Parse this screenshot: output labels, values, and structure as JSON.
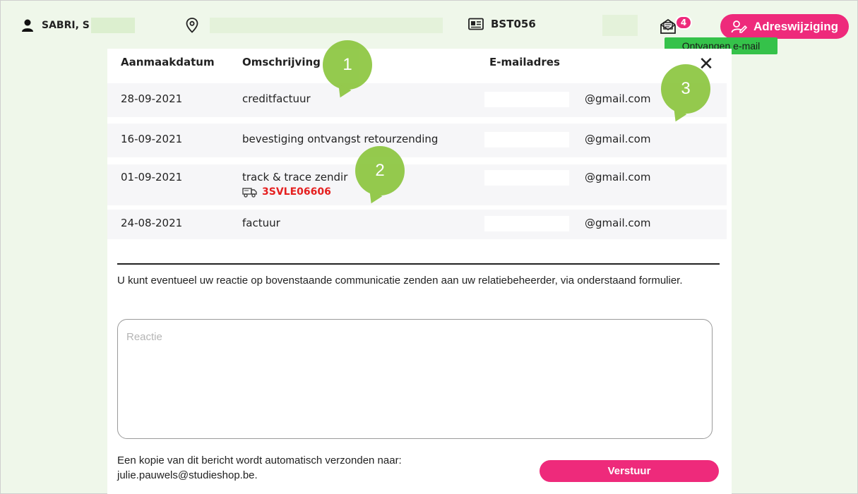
{
  "topbar": {
    "user_name": "SABRI, S",
    "card_id": "BST056",
    "mail_badge_count": "4",
    "address_change_label": "Adreswijziging",
    "tooltip": "Ontvangen e-mail"
  },
  "table": {
    "headers": [
      "Aanmaakdatum",
      "Omschrijving",
      "E-mailadres"
    ],
    "rows": [
      {
        "date": "28-09-2021",
        "description": "creditfactuur",
        "email": "@gmail.com"
      },
      {
        "date": "16-09-2021",
        "description": "bevestiging ontvangst retourzending",
        "email": "@gmail.com"
      },
      {
        "date": "01-09-2021",
        "description": "track & trace zendir",
        "email": "@gmail.com",
        "tracking": "3SVLE06606"
      },
      {
        "date": "24-08-2021",
        "description": "factuur",
        "email": "@gmail.com"
      }
    ]
  },
  "form": {
    "info": "U kunt eventueel uw reactie op bovenstaande communicatie zenden aan uw relatiebeheerder, via onderstaand formulier.",
    "placeholder": "Reactie",
    "copy_line1": "Een kopie van dit bericht wordt automatisch verzonden naar:",
    "copy_line2": "julie.pauwels@studieshop.be.",
    "send_label": "Verstuur"
  },
  "markers": [
    "1",
    "2",
    "3"
  ],
  "colors": {
    "accent": "#ee2a7b",
    "background": "#eff7ea",
    "tooltip": "#35c24a",
    "marker": "#8cc63f",
    "tracking": "#e52020"
  }
}
